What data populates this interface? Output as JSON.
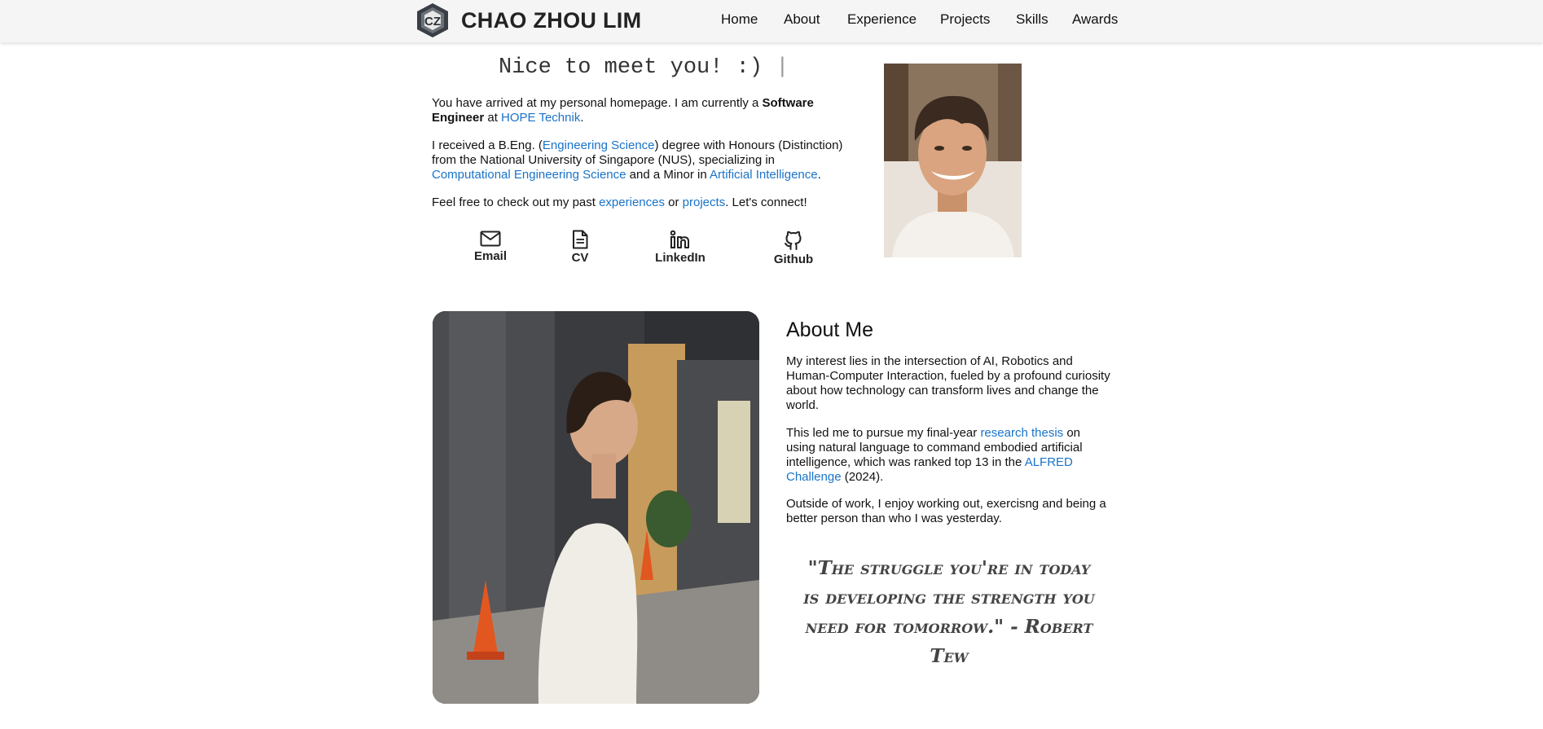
{
  "nav": {
    "brand_logo_text": "CZ",
    "brand": "CHAO ZHOU LIM",
    "links": [
      "Home",
      "About",
      "Experience",
      "Projects",
      "Skills",
      "Awards"
    ]
  },
  "hero": {
    "title": "Nice to meet you! :)",
    "cursor": "|",
    "p1": {
      "a": "You have arrived at my personal homepage. I am currently a ",
      "bold": "Software Engineer",
      "b": " at ",
      "link": "HOPE Technik",
      "c": "."
    },
    "p2": {
      "a": "I received a B.Eng. (",
      "link1": "Engineering Science",
      "b": ") degree with Honours (Distinction) from the National University of Singapore (NUS), specializing in ",
      "link2": "Computational Engineering Science",
      "c": " and a Minor in ",
      "link3": "Artificial Intelligence",
      "d": "."
    },
    "p3": {
      "a": "Feel free to check out my past ",
      "link1": "experiences",
      "b": " or ",
      "link2": "projects",
      "c": ". Let's connect!"
    },
    "socials": [
      {
        "label": "Email",
        "icon": "envelope-icon"
      },
      {
        "label": "CV",
        "icon": "document-icon"
      },
      {
        "label": "LinkedIn",
        "icon": "linkedin-icon"
      },
      {
        "label": "Github",
        "icon": "github-icon"
      }
    ]
  },
  "about": {
    "heading": "About Me",
    "p1": "My interest lies in the intersection of AI, Robotics and Human-Computer Interaction, fueled by a profound curiosity about how technology can transform lives and change the world.",
    "p2": {
      "a": "This led me to pursue my final-year ",
      "link1": "research thesis",
      "b": " on using natural language to command embodied artificial intelligence, which was ranked top 13 in the ",
      "link2": "ALFRED Challenge",
      "c": " (2024)."
    },
    "p3": "Outside of work, I enjoy working out, exercisng and being a better person than who I was yesterday.",
    "quote": "\"The struggle you're in today is developing the strength you need for tomorrow.\" - Robert Tew"
  },
  "colors": {
    "link": "#1a73c9",
    "navbar_bg": "#f5f5f5"
  }
}
